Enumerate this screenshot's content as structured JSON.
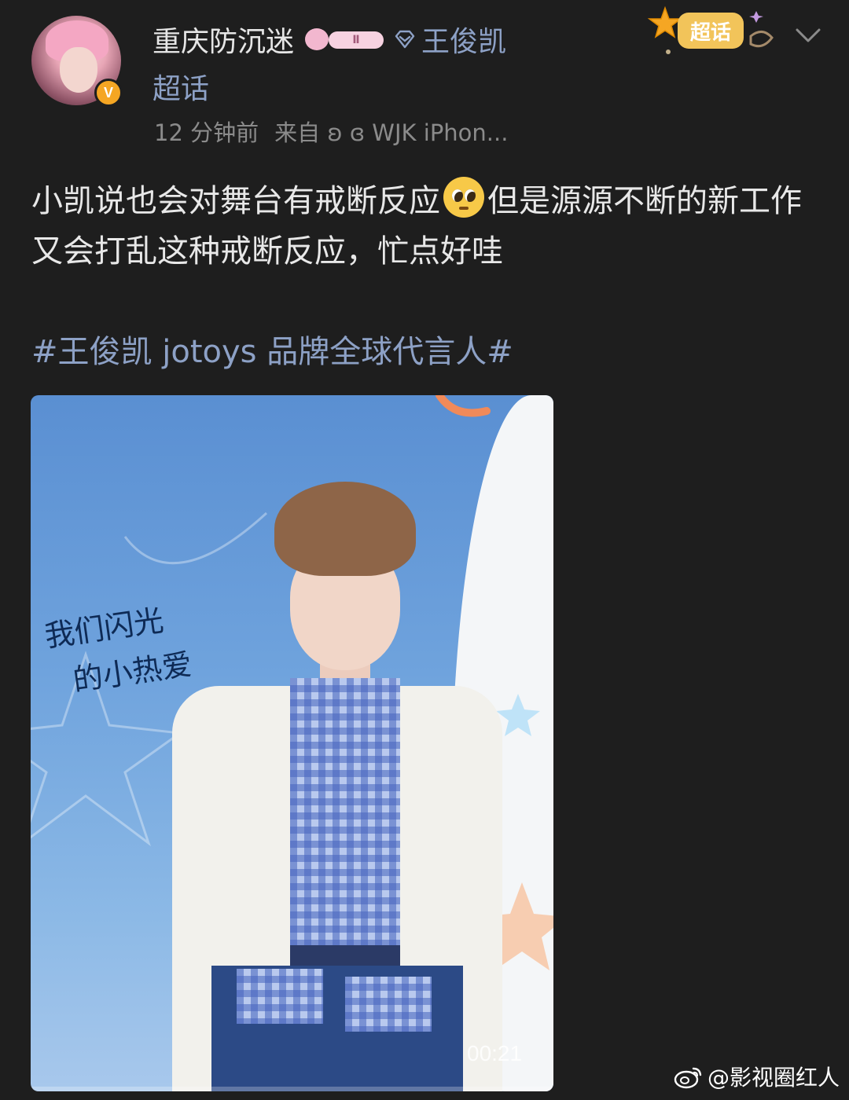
{
  "post": {
    "username": "重庆防沉迷",
    "level_badge": "Ⅱ",
    "verified_badge": "V",
    "supertopic_link": "王俊凯",
    "supertopic_link_second": "超话",
    "time_ago": "12 分钟前",
    "source": "来自 ʚ ɞ WJK iPhon...",
    "body_part1": "小凯说也会对舞台有戒断反应",
    "body_emoji": "pleading-face-emoji",
    "body_part2": "但是源源不断的新工作又会打乱这种戒断反应，忙点好哇",
    "hashtag": "#王俊凯 jotoys 品牌全球代言人#"
  },
  "sticker": {
    "label": "超话"
  },
  "video": {
    "duration": "00:21",
    "overlay_text_line1": "我们闪光",
    "overlay_text_line2": "的小热爱"
  },
  "watermark": {
    "text": "@影视圈红人"
  },
  "colors": {
    "background": "#1e1e1e",
    "link": "#8da1c6",
    "meta": "#8b8b8b",
    "text": "#e8e8e8"
  }
}
